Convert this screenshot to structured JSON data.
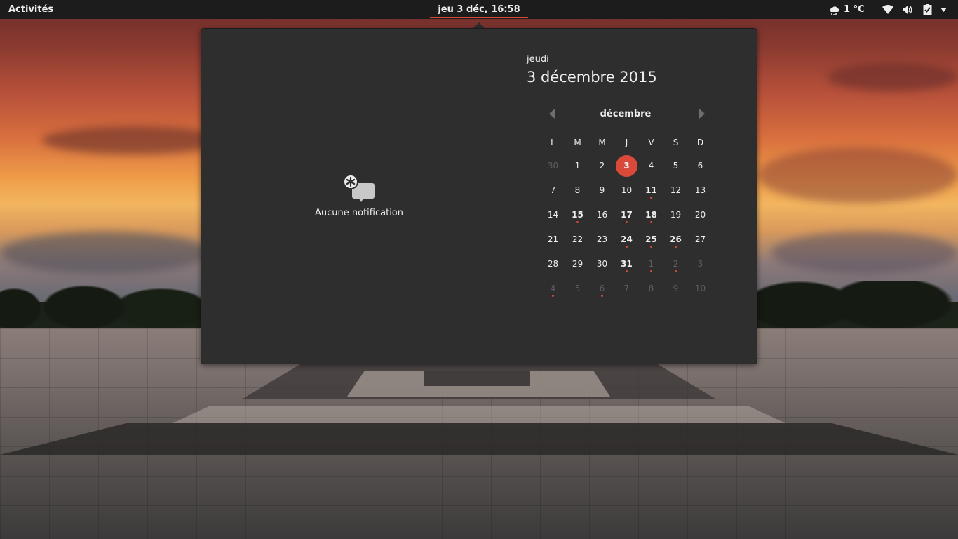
{
  "topbar": {
    "activities": "Activités",
    "clock": "jeu  3 déc, 16:58",
    "weather": "1 °C"
  },
  "icons": {
    "weather": "weather-snow-icon",
    "network": "wifi-icon",
    "volume": "volume-icon",
    "battery": "battery-icon",
    "menu": "chevron-down-icon",
    "notification": "no-notifications-icon"
  },
  "colors": {
    "accent": "#d94a3a",
    "popup_bg": "#2e2e2e",
    "bar_bg": "#1c1c1c"
  },
  "popup": {
    "no_notifications": "Aucune notification",
    "weekday": "jeudi",
    "full_date": "3 décembre 2015"
  },
  "calendar": {
    "month": "décembre",
    "weekdays": [
      "L",
      "M",
      "M",
      "J",
      "V",
      "S",
      "D"
    ],
    "weeks": [
      [
        {
          "d": "30",
          "other": true
        },
        {
          "d": "1"
        },
        {
          "d": "2"
        },
        {
          "d": "3",
          "today": true
        },
        {
          "d": "4"
        },
        {
          "d": "5"
        },
        {
          "d": "6"
        }
      ],
      [
        {
          "d": "7"
        },
        {
          "d": "8"
        },
        {
          "d": "9"
        },
        {
          "d": "10"
        },
        {
          "d": "11",
          "event": true
        },
        {
          "d": "12"
        },
        {
          "d": "13"
        }
      ],
      [
        {
          "d": "14"
        },
        {
          "d": "15",
          "event": true
        },
        {
          "d": "16"
        },
        {
          "d": "17",
          "event": true
        },
        {
          "d": "18",
          "event": true
        },
        {
          "d": "19"
        },
        {
          "d": "20"
        }
      ],
      [
        {
          "d": "21"
        },
        {
          "d": "22"
        },
        {
          "d": "23"
        },
        {
          "d": "24",
          "event": true
        },
        {
          "d": "25",
          "event": true
        },
        {
          "d": "26",
          "event": true
        },
        {
          "d": "27"
        }
      ],
      [
        {
          "d": "28"
        },
        {
          "d": "29"
        },
        {
          "d": "30"
        },
        {
          "d": "31",
          "event": true
        },
        {
          "d": "1",
          "other": true,
          "dot": true
        },
        {
          "d": "2",
          "other": true,
          "dot": true
        },
        {
          "d": "3",
          "other": true
        }
      ],
      [
        {
          "d": "4",
          "other": true,
          "dot": true
        },
        {
          "d": "5",
          "other": true
        },
        {
          "d": "6",
          "other": true,
          "dot": true
        },
        {
          "d": "7",
          "other": true
        },
        {
          "d": "8",
          "other": true
        },
        {
          "d": "9",
          "other": true
        },
        {
          "d": "10",
          "other": true
        }
      ]
    ]
  }
}
